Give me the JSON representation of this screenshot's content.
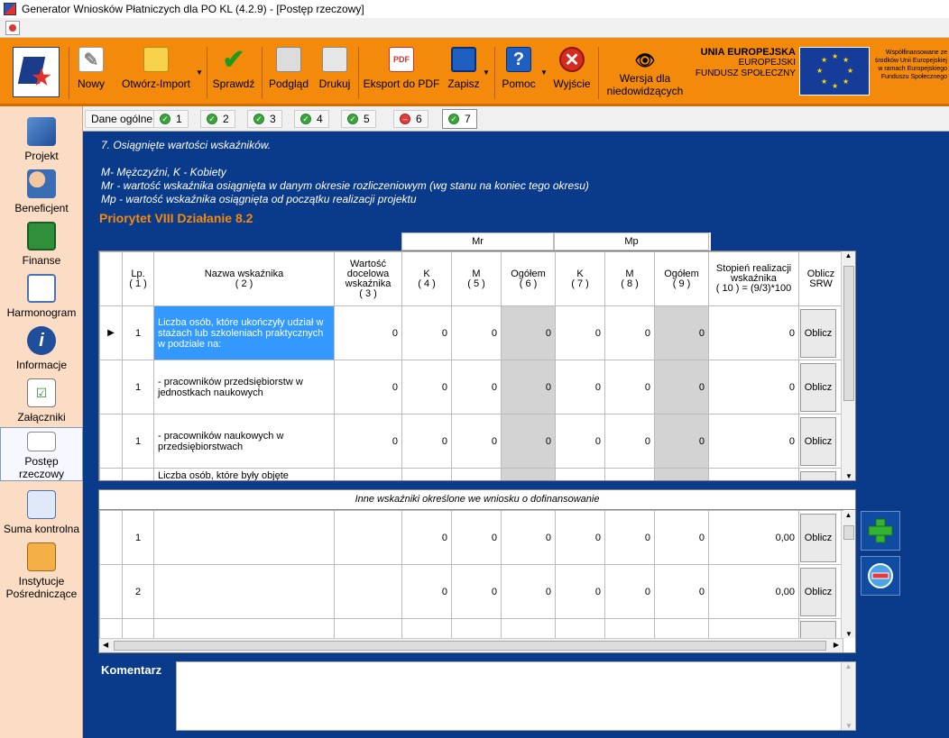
{
  "window": {
    "title": "Generator Wniosków Płatniczych dla PO KL (4.2.9) - [Postęp rzeczowy]"
  },
  "toolbar": {
    "nowy": "Nowy",
    "otworz": "Otwórz-Import",
    "sprawdz": "Sprawdź",
    "podglad": "Podgląd",
    "drukuj": "Drukuj",
    "eksport": "Eksport do PDF",
    "zapisz": "Zapisz",
    "pomoc": "Pomoc",
    "wyjscie": "Wyjście",
    "wersja1": "Wersja dla",
    "wersja2": "niedowidzących",
    "ue_title": "UNIA EUROPEJSKA",
    "ue_line2": "EUROPEJSKI",
    "ue_line3": "FUNDUSZ SPOŁECZNY",
    "cofin": "Współfinansowane ze środków Unii Europejskiej w ramach Europejskiego Funduszu Społecznego"
  },
  "sidebar": {
    "items": [
      {
        "label": "Projekt"
      },
      {
        "label": "Beneficjent"
      },
      {
        "label": "Finanse"
      },
      {
        "label": "Harmonogram"
      },
      {
        "label": "Informacje"
      },
      {
        "label": "Załączniki"
      },
      {
        "label": "Postęp rzeczowy"
      },
      {
        "label": "Suma kontrolna"
      },
      {
        "label": "Instytucje Pośredniczące"
      }
    ]
  },
  "tabs": [
    {
      "label": "Dane ogólne"
    },
    {
      "label": "1"
    },
    {
      "label": "2"
    },
    {
      "label": "3"
    },
    {
      "label": "4"
    },
    {
      "label": "5"
    },
    {
      "label": "6"
    },
    {
      "label": "7"
    }
  ],
  "intro": {
    "title": "7. Osiągnięte wartości wskaźników.",
    "line1": "M- Mężczyźni, K - Kobiety",
    "line2": "Mr - wartość wskaźnika osiągnięta w danym okresie rozliczeniowym (wg stanu na koniec tego okresu)",
    "line3": "Mp - wartość wskaźnika osiągnięta od początku realizacji projektu",
    "priorytet": "Priorytet  VIII   Działanie 8.2"
  },
  "grid1": {
    "group_mr": "Mr",
    "group_mp": "Mp",
    "headers": {
      "lp": "Lp.",
      "lp_n": "( 1 )",
      "nazwa": "Nazwa wskaźnika",
      "nazwa_n": "( 2 )",
      "wart": "Wartość docelowa wskaźnika",
      "wart_n": "( 3 )",
      "k4": "K",
      "k4_n": "( 4 )",
      "m5": "M",
      "m5_n": "( 5 )",
      "o6": "Ogółem",
      "o6_n": "( 6 )",
      "k7": "K",
      "k7_n": "( 7 )",
      "m8": "M",
      "m8_n": "( 8 )",
      "o9": "Ogółem",
      "o9_n": "( 9 )",
      "stopien": "Stopień realizacji wskaźnika",
      "stopien_n": "( 10 ) = (9/3)*100",
      "srw": "Oblicz SRW"
    },
    "rows": [
      {
        "lp": "1",
        "name": "Liczba osób, które ukończyły udział w stażach lub szkoleniach praktycznych w podziale na:",
        "v3": "0",
        "v4": "0",
        "v5": "0",
        "v6": "0",
        "v7": "0",
        "v8": "0",
        "v9": "0",
        "v10": "0",
        "btn": "Oblicz"
      },
      {
        "lp": "1",
        "name": "- pracowników przedsiębiorstw w jednostkach naukowych",
        "v3": "0",
        "v4": "0",
        "v5": "0",
        "v6": "0",
        "v7": "0",
        "v8": "0",
        "v9": "0",
        "v10": "0",
        "btn": "Oblicz"
      },
      {
        "lp": "1",
        "name": "- pracowników naukowych w przedsiębiorstwach",
        "v3": "0",
        "v4": "0",
        "v5": "0",
        "v6": "0",
        "v7": "0",
        "v8": "0",
        "v9": "0",
        "v10": "0",
        "btn": "Oblicz"
      },
      {
        "lp": "",
        "name": "Liczba osób, które były objęte",
        "v3": "",
        "v4": "",
        "v5": "",
        "v6": "",
        "v7": "",
        "v8": "",
        "v9": "",
        "v10": "",
        "btn": ""
      }
    ]
  },
  "grid2": {
    "header": "Inne wskaźniki określone we wniosku o dofinansowanie",
    "rows": [
      {
        "lp": "1",
        "v4": "0",
        "v5": "0",
        "v6": "0",
        "v7": "0",
        "v8": "0",
        "v9": "0",
        "v10": "0,00",
        "btn": "Oblicz"
      },
      {
        "lp": "2",
        "v4": "0",
        "v5": "0",
        "v6": "0",
        "v7": "0",
        "v8": "0",
        "v9": "0",
        "v10": "0,00",
        "btn": "Oblicz"
      }
    ]
  },
  "komentarz": {
    "label": "Komentarz"
  },
  "colors": {
    "orange": "#f38a0c",
    "navy": "#0a3a8a",
    "select": "#3399ff"
  }
}
